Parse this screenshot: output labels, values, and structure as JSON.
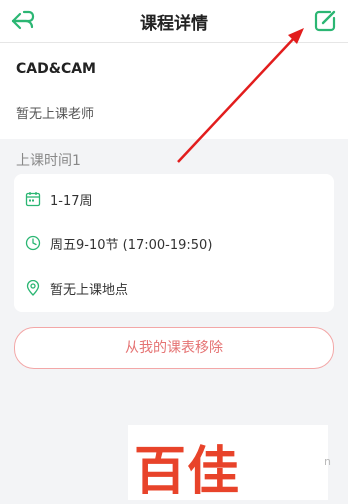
{
  "header": {
    "title": "课程详情",
    "back_icon": "back-arrow-icon",
    "edit_icon": "edit-icon",
    "accent_color": "#2bb673"
  },
  "course": {
    "name": "CAD&CAM",
    "teacher": "暂无上课老师"
  },
  "schedule": {
    "section_label": "上课时间1",
    "weeks": "1-17周",
    "time": "周五9-10节 (17:00-19:50)",
    "location": "暂无上课地点"
  },
  "actions": {
    "remove_label": "从我的课表移除",
    "remove_color": "#e57373"
  },
  "watermark": {
    "text": "百佳",
    "side": "n",
    "color": "#e8432a"
  }
}
